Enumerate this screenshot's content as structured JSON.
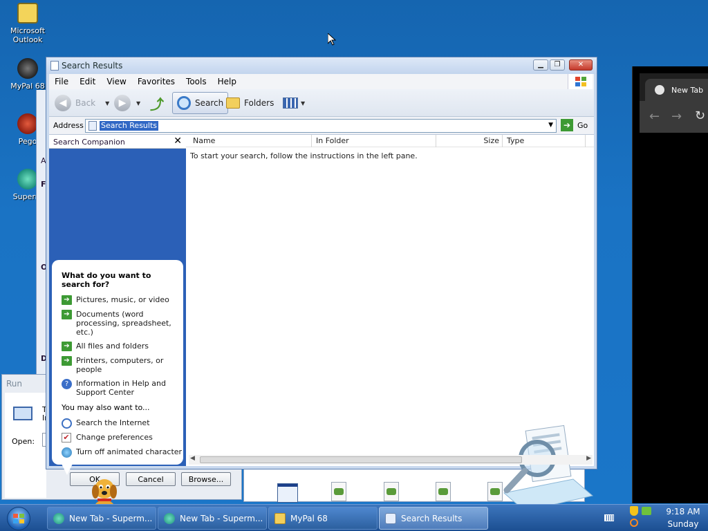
{
  "desktop": {
    "icons": [
      {
        "label": "Microsoft Outlook"
      },
      {
        "label": "MyPal 68"
      },
      {
        "label": "Pego"
      },
      {
        "label": "Superm"
      }
    ]
  },
  "window": {
    "title": "Search Results",
    "menu": [
      "File",
      "Edit",
      "View",
      "Favorites",
      "Tools",
      "Help"
    ],
    "toolbar": {
      "back_label": "Back",
      "search_label": "Search",
      "folders_label": "Folders"
    },
    "address": {
      "label": "Address",
      "value": "Search Results",
      "go_label": "Go"
    },
    "companion": {
      "title": "Search Companion",
      "question": "What do you want to search for?",
      "options": [
        "Pictures, music, or video",
        "Documents (word processing, spreadsheet, etc.)",
        "All files and folders",
        "Printers, computers, or people",
        "Information in Help and Support Center"
      ],
      "also_label": "You may also want to...",
      "extras": [
        "Search the Internet",
        "Change preferences",
        "Turn off animated character"
      ]
    },
    "columns": [
      "Name",
      "In Folder",
      "Size",
      "Type"
    ],
    "empty_message": "To start your search, follow the instructions in the left pane."
  },
  "behind_window": {
    "left_letters": [
      "A",
      "Fi",
      "O",
      "D"
    ]
  },
  "run_dialog": {
    "title": "Run",
    "open_label": "Open:",
    "text_fragment_1": "T",
    "text_fragment_2": "In",
    "ok_label": "OK",
    "cancel_label": "Cancel",
    "browse_label": "Browse..."
  },
  "browser": {
    "tab_label": "New Tab"
  },
  "taskbar": {
    "tasks": [
      {
        "label": "New Tab - Superm..."
      },
      {
        "label": "New Tab - Superm..."
      },
      {
        "label": "MyPal 68"
      },
      {
        "label": "Search Results"
      }
    ],
    "time": "9:18 AM",
    "day": "Sunday"
  }
}
